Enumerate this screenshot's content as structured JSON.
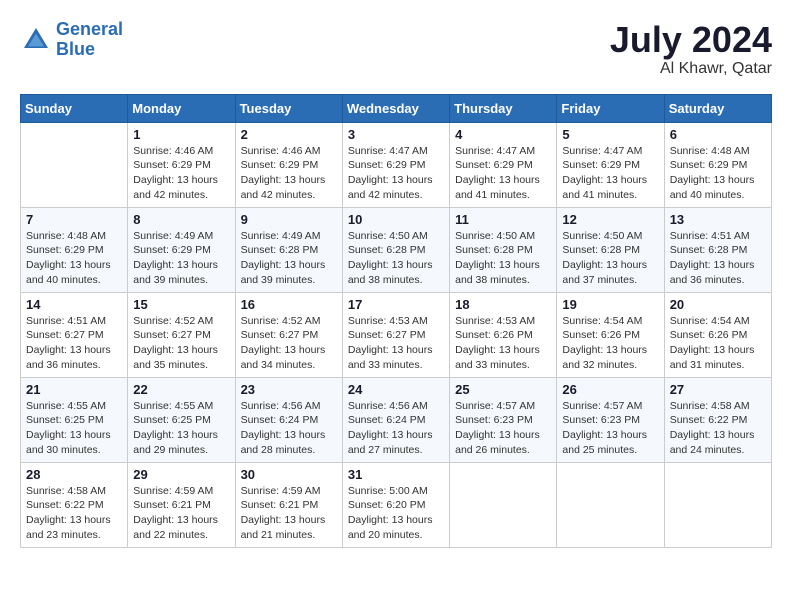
{
  "header": {
    "logo_line1": "General",
    "logo_line2": "Blue",
    "month_year": "July 2024",
    "location": "Al Khawr, Qatar"
  },
  "days_of_week": [
    "Sunday",
    "Monday",
    "Tuesday",
    "Wednesday",
    "Thursday",
    "Friday",
    "Saturday"
  ],
  "weeks": [
    [
      {
        "day": "",
        "info": ""
      },
      {
        "day": "1",
        "info": "Sunrise: 4:46 AM\nSunset: 6:29 PM\nDaylight: 13 hours\nand 42 minutes."
      },
      {
        "day": "2",
        "info": "Sunrise: 4:46 AM\nSunset: 6:29 PM\nDaylight: 13 hours\nand 42 minutes."
      },
      {
        "day": "3",
        "info": "Sunrise: 4:47 AM\nSunset: 6:29 PM\nDaylight: 13 hours\nand 42 minutes."
      },
      {
        "day": "4",
        "info": "Sunrise: 4:47 AM\nSunset: 6:29 PM\nDaylight: 13 hours\nand 41 minutes."
      },
      {
        "day": "5",
        "info": "Sunrise: 4:47 AM\nSunset: 6:29 PM\nDaylight: 13 hours\nand 41 minutes."
      },
      {
        "day": "6",
        "info": "Sunrise: 4:48 AM\nSunset: 6:29 PM\nDaylight: 13 hours\nand 40 minutes."
      }
    ],
    [
      {
        "day": "7",
        "info": "Sunrise: 4:48 AM\nSunset: 6:29 PM\nDaylight: 13 hours\nand 40 minutes."
      },
      {
        "day": "8",
        "info": "Sunrise: 4:49 AM\nSunset: 6:29 PM\nDaylight: 13 hours\nand 39 minutes."
      },
      {
        "day": "9",
        "info": "Sunrise: 4:49 AM\nSunset: 6:28 PM\nDaylight: 13 hours\nand 39 minutes."
      },
      {
        "day": "10",
        "info": "Sunrise: 4:50 AM\nSunset: 6:28 PM\nDaylight: 13 hours\nand 38 minutes."
      },
      {
        "day": "11",
        "info": "Sunrise: 4:50 AM\nSunset: 6:28 PM\nDaylight: 13 hours\nand 38 minutes."
      },
      {
        "day": "12",
        "info": "Sunrise: 4:50 AM\nSunset: 6:28 PM\nDaylight: 13 hours\nand 37 minutes."
      },
      {
        "day": "13",
        "info": "Sunrise: 4:51 AM\nSunset: 6:28 PM\nDaylight: 13 hours\nand 36 minutes."
      }
    ],
    [
      {
        "day": "14",
        "info": "Sunrise: 4:51 AM\nSunset: 6:27 PM\nDaylight: 13 hours\nand 36 minutes."
      },
      {
        "day": "15",
        "info": "Sunrise: 4:52 AM\nSunset: 6:27 PM\nDaylight: 13 hours\nand 35 minutes."
      },
      {
        "day": "16",
        "info": "Sunrise: 4:52 AM\nSunset: 6:27 PM\nDaylight: 13 hours\nand 34 minutes."
      },
      {
        "day": "17",
        "info": "Sunrise: 4:53 AM\nSunset: 6:27 PM\nDaylight: 13 hours\nand 33 minutes."
      },
      {
        "day": "18",
        "info": "Sunrise: 4:53 AM\nSunset: 6:26 PM\nDaylight: 13 hours\nand 33 minutes."
      },
      {
        "day": "19",
        "info": "Sunrise: 4:54 AM\nSunset: 6:26 PM\nDaylight: 13 hours\nand 32 minutes."
      },
      {
        "day": "20",
        "info": "Sunrise: 4:54 AM\nSunset: 6:26 PM\nDaylight: 13 hours\nand 31 minutes."
      }
    ],
    [
      {
        "day": "21",
        "info": "Sunrise: 4:55 AM\nSunset: 6:25 PM\nDaylight: 13 hours\nand 30 minutes."
      },
      {
        "day": "22",
        "info": "Sunrise: 4:55 AM\nSunset: 6:25 PM\nDaylight: 13 hours\nand 29 minutes."
      },
      {
        "day": "23",
        "info": "Sunrise: 4:56 AM\nSunset: 6:24 PM\nDaylight: 13 hours\nand 28 minutes."
      },
      {
        "day": "24",
        "info": "Sunrise: 4:56 AM\nSunset: 6:24 PM\nDaylight: 13 hours\nand 27 minutes."
      },
      {
        "day": "25",
        "info": "Sunrise: 4:57 AM\nSunset: 6:23 PM\nDaylight: 13 hours\nand 26 minutes."
      },
      {
        "day": "26",
        "info": "Sunrise: 4:57 AM\nSunset: 6:23 PM\nDaylight: 13 hours\nand 25 minutes."
      },
      {
        "day": "27",
        "info": "Sunrise: 4:58 AM\nSunset: 6:22 PM\nDaylight: 13 hours\nand 24 minutes."
      }
    ],
    [
      {
        "day": "28",
        "info": "Sunrise: 4:58 AM\nSunset: 6:22 PM\nDaylight: 13 hours\nand 23 minutes."
      },
      {
        "day": "29",
        "info": "Sunrise: 4:59 AM\nSunset: 6:21 PM\nDaylight: 13 hours\nand 22 minutes."
      },
      {
        "day": "30",
        "info": "Sunrise: 4:59 AM\nSunset: 6:21 PM\nDaylight: 13 hours\nand 21 minutes."
      },
      {
        "day": "31",
        "info": "Sunrise: 5:00 AM\nSunset: 6:20 PM\nDaylight: 13 hours\nand 20 minutes."
      },
      {
        "day": "",
        "info": ""
      },
      {
        "day": "",
        "info": ""
      },
      {
        "day": "",
        "info": ""
      }
    ]
  ]
}
